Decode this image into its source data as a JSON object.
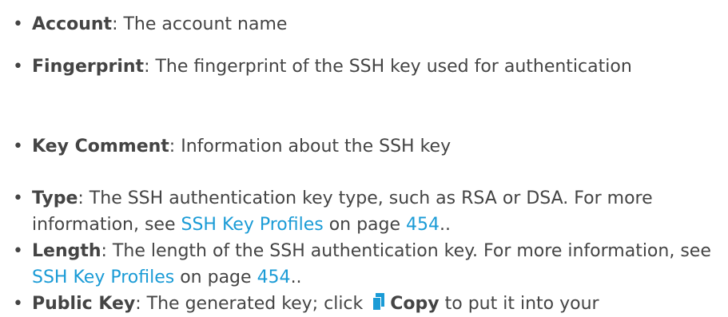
{
  "items": [
    {
      "term": "Account",
      "text": ": The account name"
    },
    {
      "term": "Fingerprint",
      "text": ": The fingerprint of the SSH key used for authentication"
    },
    {
      "term": "Key Comment",
      "text": ": Information about the SSH key"
    },
    {
      "term": "Type",
      "text": ": The SSH authentication key type, such as RSA or DSA. For more information, see ",
      "link": "SSH Key Profiles",
      "mid": " on page ",
      "page": "454",
      "end": ".."
    },
    {
      "term": "Length",
      "text": ": The length of the SSH authentication key. For more information, see ",
      "link": "SSH Key Profiles",
      "mid": " on page ",
      "page": "454",
      "end": ".."
    },
    {
      "term": "Public Key",
      "text": ": The generated key; click ",
      "icon": "copy-icon",
      "button_label": "Copy",
      "end": " to put it into your"
    }
  ],
  "bullet_char": "•",
  "colors": {
    "text": "#444444",
    "link": "#1a9bd6",
    "icon": "#1a9bd6"
  }
}
